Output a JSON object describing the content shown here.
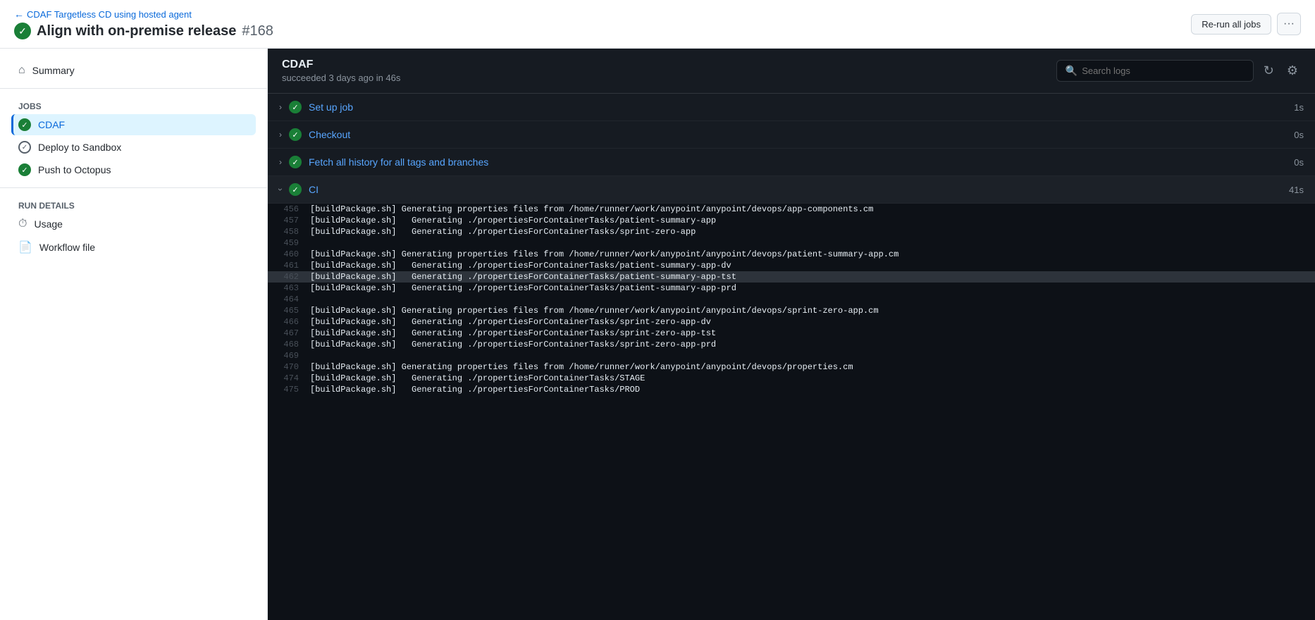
{
  "header": {
    "back_link_text": "CDAF Targetless CD using hosted agent",
    "page_title": "Align with on-premise release",
    "page_title_number": "#168",
    "rerun_button": "Re-run all jobs",
    "more_button": "···"
  },
  "sidebar": {
    "summary_label": "Summary",
    "jobs_section": "Jobs",
    "jobs": [
      {
        "id": "cdaf",
        "label": "CDAF",
        "status": "success",
        "active": true
      },
      {
        "id": "deploy",
        "label": "Deploy to Sandbox",
        "status": "circle",
        "active": false
      },
      {
        "id": "push",
        "label": "Push to Octopus",
        "status": "success",
        "active": false
      }
    ],
    "run_details_section": "Run details",
    "run_details": [
      {
        "id": "usage",
        "label": "Usage",
        "icon": "clock"
      },
      {
        "id": "workflow",
        "label": "Workflow file",
        "icon": "file"
      }
    ]
  },
  "log_panel": {
    "job_name": "CDAF",
    "job_status": "succeeded 3 days ago in 46s",
    "search_placeholder": "Search logs",
    "steps": [
      {
        "id": "setup",
        "name": "Set up job",
        "duration": "1s",
        "expanded": false
      },
      {
        "id": "checkout",
        "name": "Checkout",
        "duration": "0s",
        "expanded": false
      },
      {
        "id": "fetch",
        "name": "Fetch all history for all tags and branches",
        "duration": "0s",
        "expanded": false
      },
      {
        "id": "ci",
        "name": "CI",
        "duration": "41s",
        "expanded": true
      }
    ],
    "log_lines": [
      {
        "num": "456",
        "content": "[buildPackage.sh] Generating properties files from /home/runner/work/anypoint/anypoint/devops/app-components.cm"
      },
      {
        "num": "457",
        "content": "[buildPackage.sh]   Generating ./propertiesForContainerTasks/patient-summary-app"
      },
      {
        "num": "458",
        "content": "[buildPackage.sh]   Generating ./propertiesForContainerTasks/sprint-zero-app"
      },
      {
        "num": "459",
        "content": ""
      },
      {
        "num": "460",
        "content": "[buildPackage.sh] Generating properties files from /home/runner/work/anypoint/anypoint/devops/patient-summary-app.cm"
      },
      {
        "num": "461",
        "content": "[buildPackage.sh]   Generating ./propertiesForContainerTasks/patient-summary-app-dv"
      },
      {
        "num": "462",
        "content": "[buildPackage.sh]   Generating ./propertiesForContainerTasks/patient-summary-app-tst",
        "highlight": true
      },
      {
        "num": "463",
        "content": "[buildPackage.sh]   Generating ./propertiesForContainerTasks/patient-summary-app-prd"
      },
      {
        "num": "464",
        "content": ""
      },
      {
        "num": "465",
        "content": "[buildPackage.sh] Generating properties files from /home/runner/work/anypoint/anypoint/devops/sprint-zero-app.cm"
      },
      {
        "num": "466",
        "content": "[buildPackage.sh]   Generating ./propertiesForContainerTasks/sprint-zero-app-dv"
      },
      {
        "num": "467",
        "content": "[buildPackage.sh]   Generating ./propertiesForContainerTasks/sprint-zero-app-tst"
      },
      {
        "num": "468",
        "content": "[buildPackage.sh]   Generating ./propertiesForContainerTasks/sprint-zero-app-prd"
      },
      {
        "num": "469",
        "content": ""
      },
      {
        "num": "470",
        "content": "[buildPackage.sh] Generating properties files from /home/runner/work/anypoint/anypoint/devops/properties.cm"
      },
      {
        "num": "474",
        "content": "[buildPackage.sh]   Generating ./propertiesForContainerTasks/STAGE"
      },
      {
        "num": "475",
        "content": "[buildPackage.sh]   Generating ./propertiesForContainerTasks/PROD"
      }
    ]
  }
}
